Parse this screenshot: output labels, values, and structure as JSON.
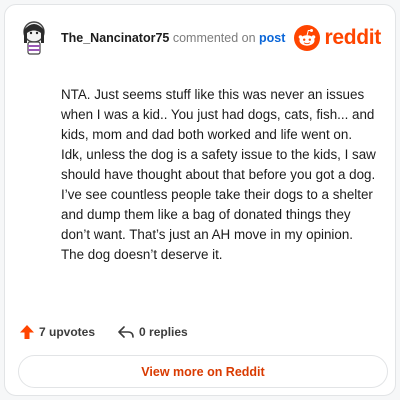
{
  "header": {
    "username": "The_Nancinator75",
    "commented_on": "commented on",
    "post_link": "post"
  },
  "brand": {
    "wordmark": "reddit",
    "logo_icon": "reddit-snoo-icon",
    "color": "#ff4500"
  },
  "comment": {
    "text": "NTA. Just seems stuff like this was never an issues when I was a kid.. You just had dogs, cats, fish... and kids, mom and dad both worked and life went on. Idk, unless the dog is a safety issue to the kids, I saw should have thought about that before you got a dog. I’ve see countless people take their dogs to a shelter and dump them like a bag of donated things they don’t want. That’s just an AH move in my opinion. The dog doesn’t deserve it."
  },
  "actions": {
    "upvotes": "7 upvotes",
    "replies": "0 replies",
    "upvote_icon": "upvote-arrow-icon",
    "reply_icon": "reply-arrow-icon"
  },
  "footer": {
    "view_more": "View more on Reddit"
  }
}
